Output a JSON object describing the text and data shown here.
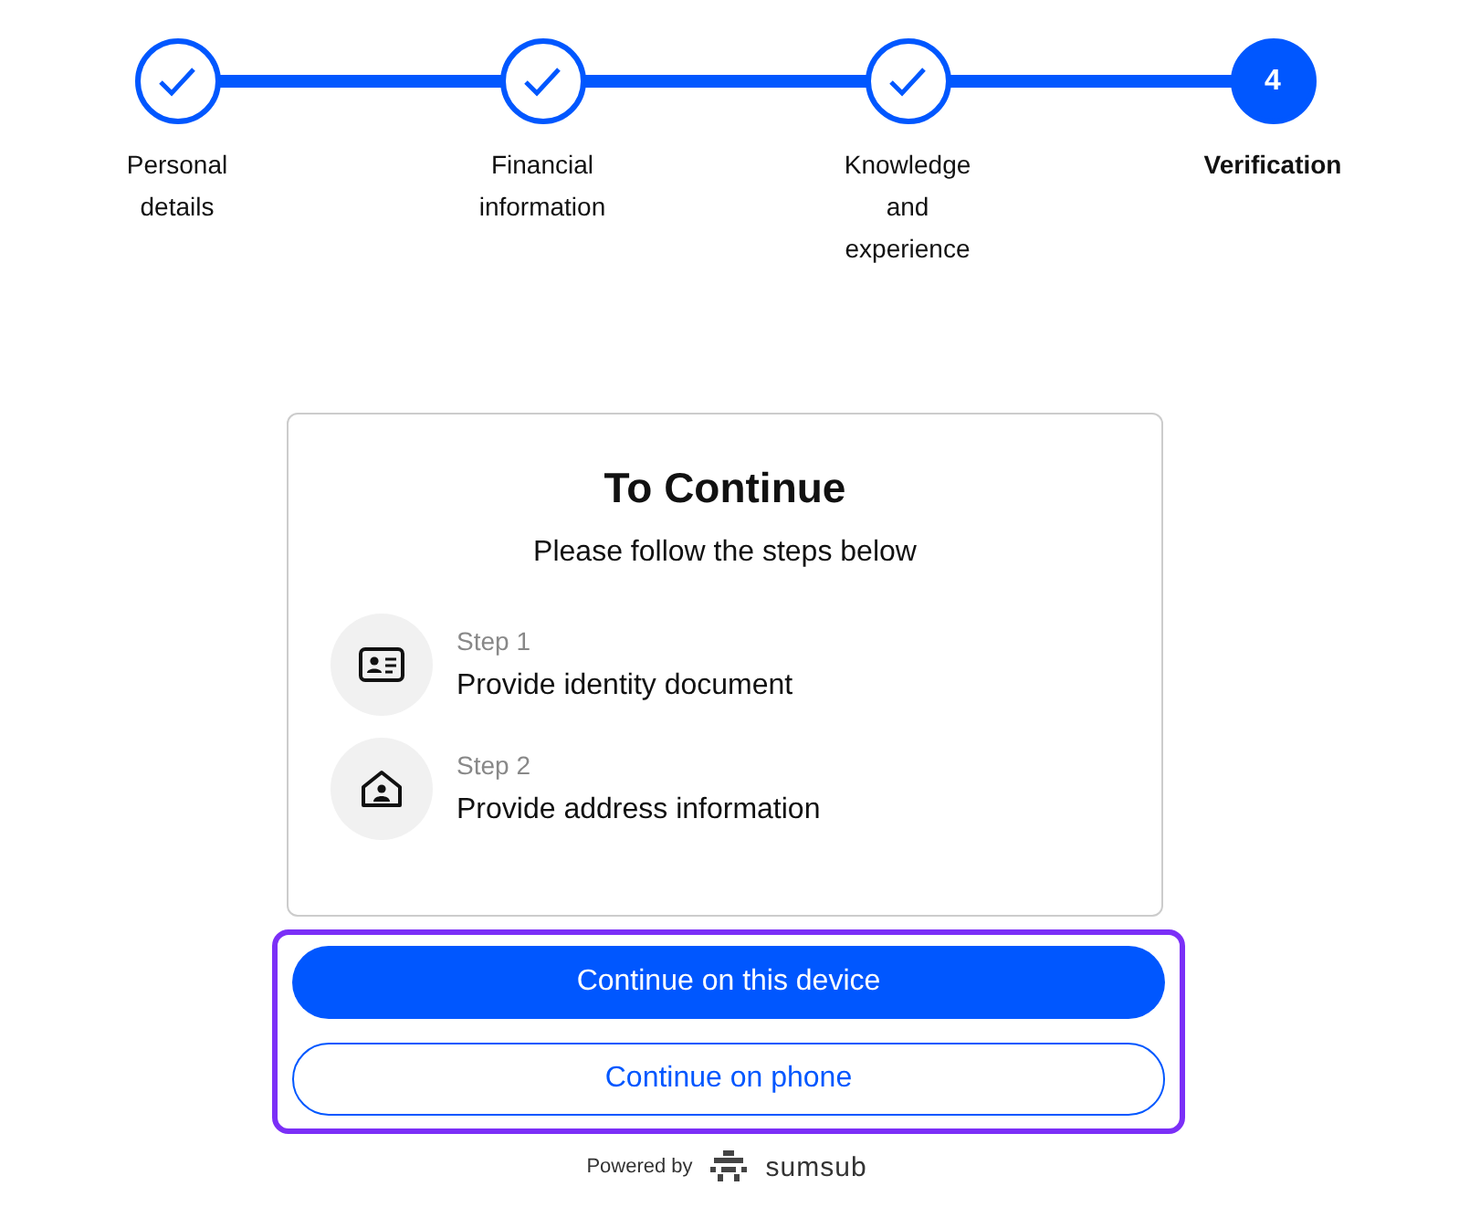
{
  "stepper": {
    "steps": [
      {
        "label": "Personal details",
        "completed": true,
        "selected": false
      },
      {
        "label": "Financial information",
        "completed": true,
        "selected": false
      },
      {
        "label": "Knowledge and experience",
        "completed": true,
        "selected": false
      },
      {
        "label": "Verification",
        "completed": false,
        "selected": true,
        "number": "4"
      }
    ]
  },
  "card": {
    "title": "To Continue",
    "subtitle": "Please follow the steps below",
    "steps": [
      {
        "kind": "id-card",
        "caption": "Step 1",
        "text": "Provide identity document"
      },
      {
        "kind": "home",
        "caption": "Step 2",
        "text": "Provide address information"
      }
    ]
  },
  "actions": {
    "highlighted": true,
    "buttons": [
      {
        "label": "Continue on this device",
        "kind": "primary"
      },
      {
        "label": "Continue on phone",
        "kind": "secondary"
      }
    ]
  },
  "footer": {
    "powered_by": "Powered by",
    "brand": "sumsub"
  }
}
